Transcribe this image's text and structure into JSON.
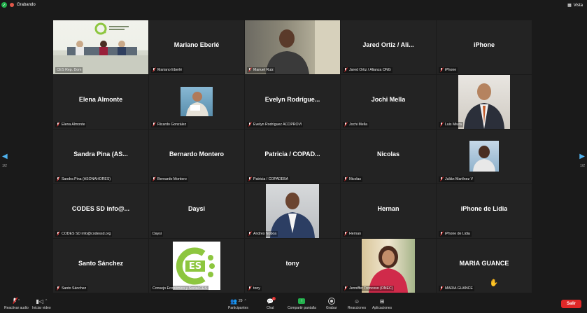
{
  "topbar": {
    "recording_label": "Grabando",
    "view_label": "Vista"
  },
  "pagination": {
    "left": "1/2",
    "right": "1/2"
  },
  "tiles": [
    {
      "title": "",
      "label": "CES Rep. Dom"
    },
    {
      "title": "Mariano Eberlé",
      "label": "Mariano Eberlé"
    },
    {
      "title": "",
      "label": "Manuel Ruiz"
    },
    {
      "title": "Jared Ortiz / Ali...",
      "label": "Jared Ortiz / Alianza ONG"
    },
    {
      "title": "iPhone",
      "label": "iPhone"
    },
    {
      "title": "Elena Almonte",
      "label": "Elena Almonte"
    },
    {
      "title": "",
      "label": "Ricardo González"
    },
    {
      "title": "Evelyn Rodrígue...",
      "label": "Evelyn Rodríguez ACOPROVI"
    },
    {
      "title": "Jochi Mella",
      "label": "Jochi Mella"
    },
    {
      "title": "",
      "label": "Luis Miura"
    },
    {
      "title": "Sandra Pina (AS...",
      "label": "Sandra Pina (ASONAHORES)"
    },
    {
      "title": "Bernardo Montero",
      "label": "Bernardo Montero"
    },
    {
      "title": "Patricia / COPAD...",
      "label": "Patricia / COPADEBA"
    },
    {
      "title": "Nicolas",
      "label": "Nicolas"
    },
    {
      "title": "",
      "label": "Julián Martínez V"
    },
    {
      "title": "CODES SD info@...",
      "label": "CODES SD info@codessd.org"
    },
    {
      "title": "Daysi",
      "label": "Daysi"
    },
    {
      "title": "",
      "label": "Andres Noboa"
    },
    {
      "title": "Hernan",
      "label": "Hernan"
    },
    {
      "title": "iPhone de Lidia",
      "label": "iPhone de Lidia"
    },
    {
      "title": "Santo Sánchez",
      "label": "Santo Sánchez"
    },
    {
      "title": "",
      "label": "Consejo Económico y Social CES"
    },
    {
      "title": "tony",
      "label": "tony"
    },
    {
      "title": "",
      "label": "Jenniffer Troncoso (ONEC)"
    },
    {
      "title": "MARIA GUANCE",
      "label": "MARIA GUANCE"
    }
  ],
  "toolbar": {
    "audio_label": "Reactivar audio",
    "video_label": "Iniciar video",
    "participants_label": "Participantes",
    "participants_count": "29",
    "chat_label": "Chat",
    "chat_badge": "1",
    "share_label": "Compartir pantalla",
    "record_label": "Grabar",
    "reactions_label": "Reacciones",
    "apps_label": "Aplicaciones",
    "leave_label": "Salir"
  },
  "colors": {
    "accent_green": "#23b14d",
    "share_green": "#23b14d",
    "leave_red": "#e02828",
    "active_border": "#a8d82a",
    "nav_blue": "#4fb2ef"
  }
}
